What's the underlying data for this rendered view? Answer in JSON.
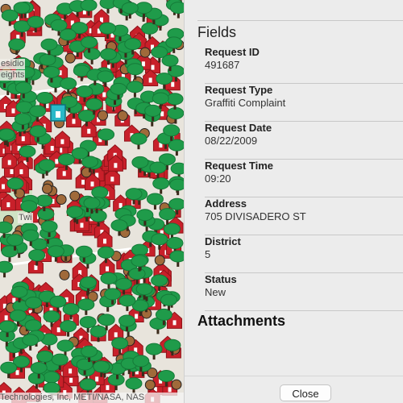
{
  "map": {
    "labels": {
      "presidio": "esidio",
      "heights": "eights",
      "twin": "Twi"
    },
    "attribution": "Technologies, Inc, METI/NASA, NAS",
    "colors": {
      "base": "#e8e4dc",
      "tree": "#1f9b4a",
      "tree_dark": "#157a38",
      "house": "#c8202a",
      "house_dark": "#8e1419",
      "brown": "#a06a3a",
      "road": "#ffffff",
      "park": "#cfe3c4"
    }
  },
  "panel": {
    "fields_title": "Fields",
    "fields": [
      {
        "label": "Request ID",
        "value": "491687"
      },
      {
        "label": "Request Type",
        "value": "Graffiti Complaint"
      },
      {
        "label": "Request Date",
        "value": "08/22/2009"
      },
      {
        "label": "Request Time",
        "value": "09:20"
      },
      {
        "label": "Address",
        "value": "705 DIVISADERO ST"
      },
      {
        "label": "District",
        "value": "5"
      },
      {
        "label": "Status",
        "value": "New"
      }
    ],
    "attachments_title": "Attachments",
    "close_label": "Close"
  }
}
